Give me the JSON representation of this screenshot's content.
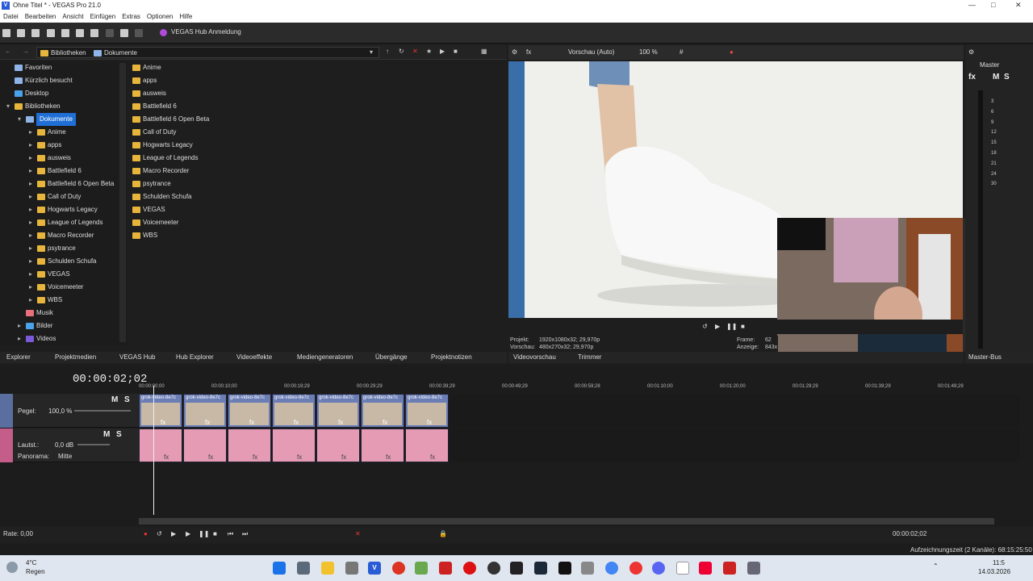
{
  "window": {
    "title": "Ohne Titel * - VEGAS Pro 21.0",
    "app_icon": "V"
  },
  "menu": [
    "Datei",
    "Bearbeiten",
    "Ansicht",
    "Einfügen",
    "Extras",
    "Optionen",
    "Hilfe"
  ],
  "toolbar": {
    "hub_label": "VEGAS Hub Anmeldung"
  },
  "explorer": {
    "breadcrumb": [
      "Bibliotheken",
      "Dokumente"
    ],
    "tree": [
      {
        "label": "Favoriten",
        "icon": "star-icon",
        "indent": 0
      },
      {
        "label": "Kürzlich besucht",
        "icon": "clock-icon",
        "indent": 0
      },
      {
        "label": "Desktop",
        "icon": "desktop-icon",
        "indent": 0
      },
      {
        "label": "Bibliotheken",
        "icon": "folder-icon",
        "indent": 0
      },
      {
        "label": "Dokumente",
        "icon": "document-icon",
        "indent": 1,
        "selected": true
      },
      {
        "label": "Anime",
        "icon": "folder-icon",
        "indent": 2
      },
      {
        "label": "apps",
        "icon": "folder-icon",
        "indent": 2
      },
      {
        "label": "ausweis",
        "icon": "folder-icon",
        "indent": 2
      },
      {
        "label": "Battlefield 6",
        "icon": "folder-icon",
        "indent": 2
      },
      {
        "label": "Battlefield 6 Open Beta",
        "icon": "folder-icon",
        "indent": 2
      },
      {
        "label": "Call of Duty",
        "icon": "folder-icon",
        "indent": 2
      },
      {
        "label": "Hogwarts Legacy",
        "icon": "folder-icon",
        "indent": 2
      },
      {
        "label": "League of Legends",
        "icon": "folder-icon",
        "indent": 2
      },
      {
        "label": "Macro Recorder",
        "icon": "folder-icon",
        "indent": 2
      },
      {
        "label": "psytrance",
        "icon": "folder-icon",
        "indent": 2
      },
      {
        "label": "Schulden Schufa",
        "icon": "folder-icon",
        "indent": 2
      },
      {
        "label": "VEGAS",
        "icon": "folder-icon",
        "indent": 2
      },
      {
        "label": "Voicemeeter",
        "icon": "folder-icon",
        "indent": 2
      },
      {
        "label": "WBS",
        "icon": "folder-icon",
        "indent": 2
      },
      {
        "label": "Musik",
        "icon": "music-icon",
        "indent": 1
      },
      {
        "label": "Bilder",
        "icon": "image-icon",
        "indent": 1
      },
      {
        "label": "Videos",
        "icon": "video-icon",
        "indent": 1
      }
    ],
    "files": [
      "Anime",
      "apps",
      "ausweis",
      "Battlefield 6",
      "Battlefield 6 Open Beta",
      "Call of Duty",
      "Hogwarts Legacy",
      "League of Legends",
      "Macro Recorder",
      "psytrance",
      "Schulden Schufa",
      "VEGAS",
      "Voicemeeter",
      "WBS"
    ]
  },
  "tabs": [
    "Explorer",
    "Projektmedien",
    "VEGAS Hub",
    "Hub Explorer",
    "Videoeffekte",
    "Mediengeneratoren",
    "Übergänge",
    "Projektnotizen"
  ],
  "preview": {
    "mode": "Vorschau (Auto)",
    "zoom": "100 %",
    "projekt_label": "Projekt:",
    "projekt_value": "1920x1080x32; 29,970p",
    "vorschau_label": "Vorschau:",
    "vorschau_value": "480x270x32; 29,970p",
    "frame_label": "Frame:",
    "frame_value": "62",
    "anzeige_label": "Anzeige:",
    "anzeige_value": "843x",
    "tabs": [
      "Videovorschau",
      "Trimmer"
    ]
  },
  "master": {
    "label": "Master",
    "tab": "Master-Bus",
    "db_ticks": [
      "3",
      "6",
      "9",
      "12",
      "15",
      "18",
      "21",
      "24",
      "30"
    ]
  },
  "timeline": {
    "timecode": "00:00:02;02",
    "ruler": [
      "00:00:00;00",
      "00:00:10;00",
      "00:00:19;29",
      "00:00:29;29",
      "00:00:39;29",
      "00:00:49;29",
      "00:00:59;28",
      "00:01:10;00",
      "00:01:20;00",
      "00:01:29;29",
      "00:01:39;29",
      "00:01:49;29"
    ],
    "video_track": {
      "m": "M",
      "s": "S",
      "level_label": "Pegel:",
      "level_value": "100,0 %"
    },
    "audio_track": {
      "m": "M",
      "s": "S",
      "vol_label": "Lautst.:",
      "vol_value": "0,0 dB",
      "pan_label": "Panorama:",
      "pan_value": "Mitte"
    },
    "clip_label": "grok-video-8e7c",
    "fx": "fx"
  },
  "transport": {
    "rate": "Rate: 0,00",
    "time": "00:00:02;02"
  },
  "status": {
    "recording": "Aufzeichnungszeit (2 Kanäle): 68:15:25:50"
  },
  "taskbar": {
    "weather_temp": "4°C",
    "weather_text": "Regen",
    "time": "11:5",
    "date": "14.03.2026"
  }
}
